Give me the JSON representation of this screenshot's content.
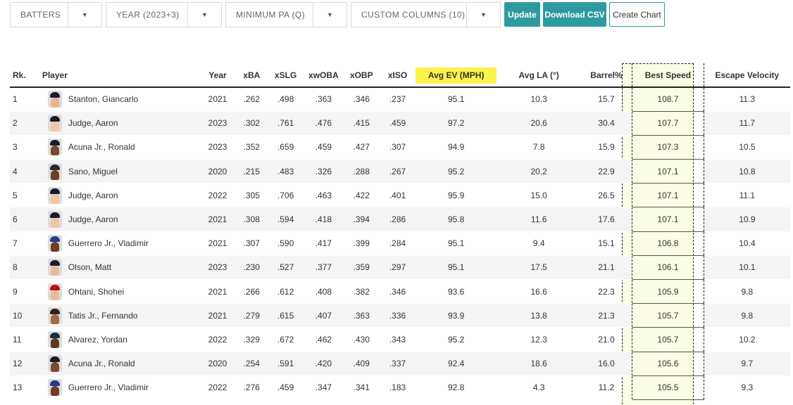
{
  "toolbar": {
    "dropdowns": [
      "BATTERS",
      "YEAR (2023+3)",
      "MINIMUM PA (Q)",
      "CUSTOM COLUMNS (10)"
    ],
    "buttons": [
      "Update",
      "Download CSV",
      "Create Chart"
    ]
  },
  "table": {
    "headers": [
      "Rk.",
      "Player",
      "Year",
      "xBA",
      "xSLG",
      "xwOBA",
      "xOBP",
      "xISO",
      "Avg EV (MPH)",
      "Avg LA (°)",
      "Barrel%",
      "Best Speed",
      "Escape Velocity"
    ],
    "rows": [
      {
        "rk": "1",
        "player": "Stanton, Giancarlo",
        "year": "2021",
        "xba": ".262",
        "xslg": ".498",
        "xwoba": ".363",
        "xobp": ".346",
        "xiso": ".237",
        "ev": "95.1",
        "la": "10.3",
        "barrel": "15.7",
        "best": "108.7",
        "escape": "11.3",
        "skin": "#e7b48f",
        "cap": "#1b1b2f"
      },
      {
        "rk": "2",
        "player": "Judge, Aaron",
        "year": "2023",
        "xba": ".302",
        "xslg": ".761",
        "xwoba": ".476",
        "xobp": ".415",
        "xiso": ".459",
        "ev": "97.2",
        "la": "20.6",
        "barrel": "30.4",
        "best": "107.7",
        "escape": "11.7",
        "skin": "#f0c5a2",
        "cap": "#1b1b2f"
      },
      {
        "rk": "3",
        "player": "Acuna Jr., Ronald",
        "year": "2023",
        "xba": ".352",
        "xslg": ".659",
        "xwoba": ".459",
        "xobp": ".427",
        "xiso": ".307",
        "ev": "94.9",
        "la": "7.8",
        "barrel": "15.9",
        "best": "107.3",
        "escape": "10.5",
        "skin": "#7a4a30",
        "cap": "#1b1b2f"
      },
      {
        "rk": "4",
        "player": "Sano, Miguel",
        "year": "2020",
        "xba": ".215",
        "xslg": ".483",
        "xwoba": ".326",
        "xobp": ".288",
        "xiso": ".267",
        "ev": "95.2",
        "la": "20.2",
        "barrel": "22.9",
        "best": "107.1",
        "escape": "10.8",
        "skin": "#6b3f28",
        "cap": "#2a2a2a"
      },
      {
        "rk": "5",
        "player": "Judge, Aaron",
        "year": "2022",
        "xba": ".305",
        "xslg": ".706",
        "xwoba": ".463",
        "xobp": ".422",
        "xiso": ".401",
        "ev": "95.9",
        "la": "15.0",
        "barrel": "26.5",
        "best": "107.1",
        "escape": "11.1",
        "skin": "#f0c5a2",
        "cap": "#1b1b2f"
      },
      {
        "rk": "6",
        "player": "Judge, Aaron",
        "year": "2021",
        "xba": ".308",
        "xslg": ".594",
        "xwoba": ".418",
        "xobp": ".394",
        "xiso": ".286",
        "ev": "95.8",
        "la": "11.6",
        "barrel": "17.6",
        "best": "107.1",
        "escape": "10.9",
        "skin": "#f0c5a2",
        "cap": "#1b1b2f"
      },
      {
        "rk": "7",
        "player": "Guerrero Jr., Vladimir",
        "year": "2021",
        "xba": ".307",
        "xslg": ".590",
        "xwoba": ".417",
        "xobp": ".399",
        "xiso": ".284",
        "ev": "95.1",
        "la": "9.4",
        "barrel": "15.1",
        "best": "106.8",
        "escape": "10.4",
        "skin": "#6b3f28",
        "cap": "#2b3a8a"
      },
      {
        "rk": "8",
        "player": "Olson, Matt",
        "year": "2023",
        "xba": ".230",
        "xslg": ".527",
        "xwoba": ".377",
        "xobp": ".359",
        "xiso": ".297",
        "ev": "95.1",
        "la": "17.5",
        "barrel": "21.1",
        "best": "106.1",
        "escape": "10.1",
        "skin": "#e9b995",
        "cap": "#1b1b2f"
      },
      {
        "rk": "9",
        "player": "Ohtani, Shohei",
        "year": "2021",
        "xba": ".266",
        "xslg": ".612",
        "xwoba": ".408",
        "xobp": ".382",
        "xiso": ".346",
        "ev": "93.6",
        "la": "16.6",
        "barrel": "22.3",
        "best": "105.9",
        "escape": "9.8",
        "skin": "#e8bb96",
        "cap": "#b5121b"
      },
      {
        "rk": "10",
        "player": "Tatis Jr., Fernando",
        "year": "2021",
        "xba": ".279",
        "xslg": ".615",
        "xwoba": ".407",
        "xobp": ".363",
        "xiso": ".336",
        "ev": "93.9",
        "la": "13.8",
        "barrel": "21.3",
        "best": "105.7",
        "escape": "9.8",
        "skin": "#a06a45",
        "cap": "#2f241d"
      },
      {
        "rk": "11",
        "player": "Alvarez, Yordan",
        "year": "2022",
        "xba": ".329",
        "xslg": ".672",
        "xwoba": ".462",
        "xobp": ".430",
        "xiso": ".343",
        "ev": "95.2",
        "la": "12.3",
        "barrel": "21.0",
        "best": "105.7",
        "escape": "10.2",
        "skin": "#5e3a26",
        "cap": "#1f2a44"
      },
      {
        "rk": "12",
        "player": "Acuna Jr., Ronald",
        "year": "2020",
        "xba": ".254",
        "xslg": ".591",
        "xwoba": ".420",
        "xobp": ".409",
        "xiso": ".337",
        "ev": "92.4",
        "la": "18.6",
        "barrel": "16.0",
        "best": "105.6",
        "escape": "9.7",
        "skin": "#7a4a30",
        "cap": "#1b1b2f"
      },
      {
        "rk": "13",
        "player": "Guerrero Jr., Vladimir",
        "year": "2022",
        "xba": ".276",
        "xslg": ".459",
        "xwoba": ".347",
        "xobp": ".341",
        "xiso": ".183",
        "ev": "92.8",
        "la": "4.3",
        "barrel": "11.2",
        "best": "105.5",
        "escape": "9.3",
        "skin": "#6b3f28",
        "cap": "#2b3a8a"
      }
    ]
  },
  "colors": {
    "accent": "#2e9aa0",
    "highlight": "#fdf34a",
    "highlight_column": "#fcfde6"
  },
  "icons": {
    "dropdown": "caret-down-icon",
    "player": "player-headshot-icon"
  }
}
